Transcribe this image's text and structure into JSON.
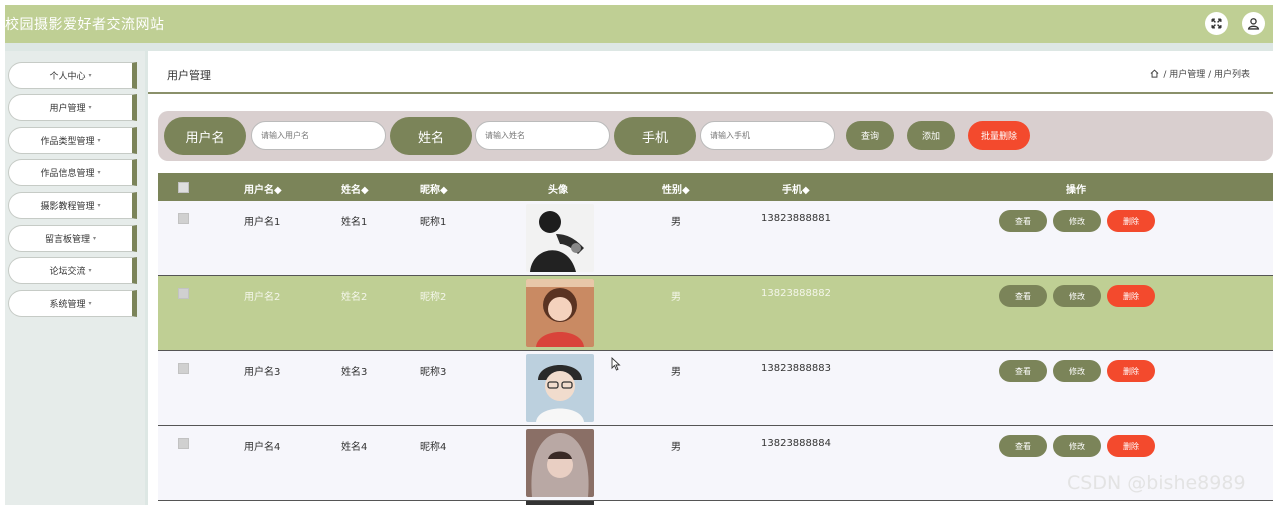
{
  "header": {
    "site_title": "校园摄影爱好者交流网站",
    "fullscreen_icon": "expand-icon",
    "user_icon": "user-icon"
  },
  "sidebar": {
    "items": [
      {
        "label": "个人中心"
      },
      {
        "label": "用户管理"
      },
      {
        "label": "作品类型管理"
      },
      {
        "label": "作品信息管理"
      },
      {
        "label": "摄影教程管理"
      },
      {
        "label": "留言板管理"
      },
      {
        "label": "论坛交流"
      },
      {
        "label": "系统管理"
      }
    ],
    "caret": "▾"
  },
  "breadcrumb": {
    "title": "用户管理",
    "path": "/ 用户管理 / 用户列表",
    "home_icon": "home-icon"
  },
  "search": {
    "username_label": "用户名",
    "username_placeholder": "请输入用户名",
    "name_label": "姓名",
    "name_placeholder": "请输入姓名",
    "phone_label": "手机",
    "phone_placeholder": "请输入手机",
    "query_label": "查询",
    "add_label": "添加",
    "batch_delete_label": "批量删除"
  },
  "table": {
    "headers": {
      "username": "用户名◆",
      "name": "姓名◆",
      "nickname": "昵称◆",
      "avatar": "头像",
      "gender": "性别◆",
      "phone": "手机◆",
      "actions": "操作"
    },
    "rows": [
      {
        "username": "用户名1",
        "name": "姓名1",
        "nickname": "昵称1",
        "gender": "男",
        "phone": "13823888881"
      },
      {
        "username": "用户名2",
        "name": "姓名2",
        "nickname": "昵称2",
        "gender": "男",
        "phone": "13823888882"
      },
      {
        "username": "用户名3",
        "name": "姓名3",
        "nickname": "昵称3",
        "gender": "男",
        "phone": "13823888883"
      },
      {
        "username": "用户名4",
        "name": "姓名4",
        "nickname": "昵称4",
        "gender": "男",
        "phone": "13823888884"
      }
    ],
    "view_label": "查看",
    "edit_label": "修改",
    "delete_label": "删除"
  },
  "colors": {
    "accent": "#7b8459",
    "header": "#bfcf94",
    "danger": "#f34a2d"
  },
  "watermark": "CSDN @bishe8989"
}
